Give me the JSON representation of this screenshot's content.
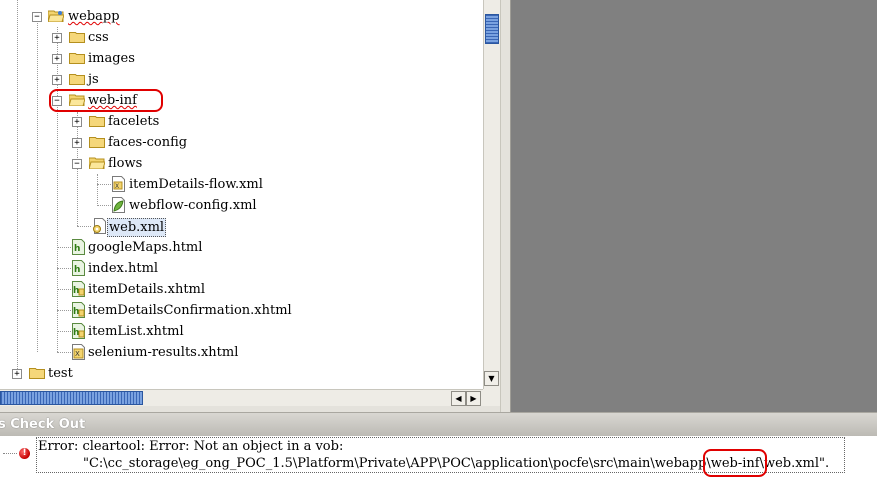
{
  "tree": {
    "items": [
      {
        "label": "webapp"
      },
      {
        "label": "css"
      },
      {
        "label": "images"
      },
      {
        "label": "js"
      },
      {
        "label": "web-inf"
      },
      {
        "label": "facelets"
      },
      {
        "label": "faces-config"
      },
      {
        "label": "flows"
      },
      {
        "label": "itemDetails-flow.xml"
      },
      {
        "label": "webflow-config.xml"
      },
      {
        "label": "web.xml"
      },
      {
        "label": "googleMaps.html"
      },
      {
        "label": "index.html"
      },
      {
        "label": "itemDetails.xhtml"
      },
      {
        "label": "itemDetailsConfirmation.xhtml"
      },
      {
        "label": "itemList.xhtml"
      },
      {
        "label": "selenium-results.xhtml"
      },
      {
        "label": "test"
      }
    ],
    "expander_open": "−",
    "expander_closed": "+"
  },
  "panel": {
    "title": "s Check Out"
  },
  "error": {
    "line1": "Error: cleartool: Error: Not an object in a vob:",
    "path_prefix": "\"C:\\cc_storage\\eg_ong_POC_1.5\\Platform\\Private\\APP\\POC\\application\\pocfe\\src\\main\\webapp",
    "path_highlight": "\\web-inf\\",
    "path_suffix": "web.xml\".",
    "icon_glyph": "!"
  },
  "colors": {
    "highlight": "#e00000",
    "scroll_thumb": "#4d7ecf",
    "editor_bg": "#808080"
  }
}
